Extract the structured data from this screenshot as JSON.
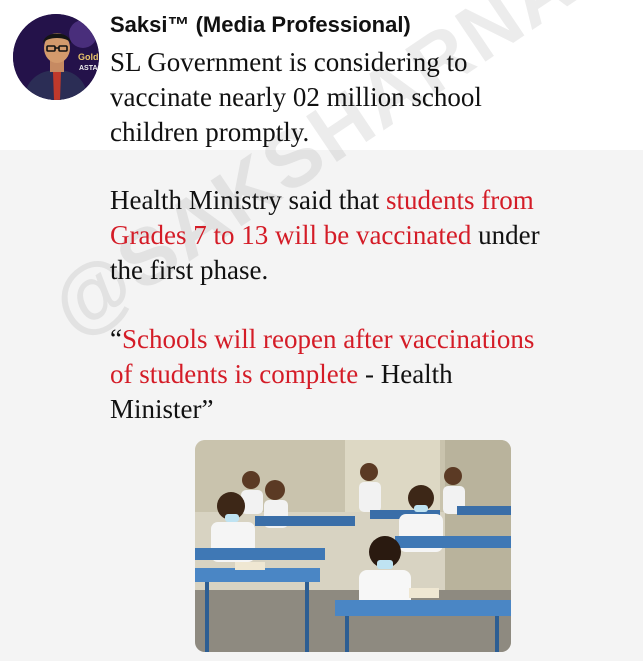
{
  "author": "Saksi™ (Media Professional)",
  "avatar_badge": [
    "Gold",
    "ASTA"
  ],
  "watermark": "@SAKSHARNAN",
  "post": {
    "p1": "SL Government is considering to\nvaccinate nearly 02 million school\nchildren promptly.",
    "p2_a": "Health Ministry said that ",
    "p2_red": "students from\nGrades 7 to 13 will be vaccinated",
    "p2_b": " under\nthe first phase.",
    "p3_q": "“",
    "p3_red": "Schools will reopen after vaccinations\nof students is complete",
    "p3_b": " - Health\nMinister”"
  },
  "colors": {
    "accent_red": "#d41c27",
    "text": "#111111"
  }
}
